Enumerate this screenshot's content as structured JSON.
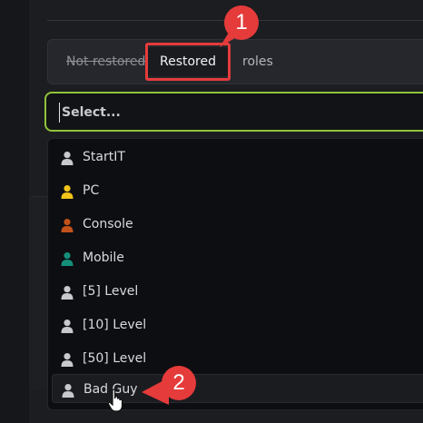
{
  "toggle": {
    "not_restored": "Not restored",
    "restored": "Restored",
    "roles": "roles"
  },
  "select": {
    "placeholder": "Select..."
  },
  "options": [
    {
      "label": "StartIT",
      "color": "#c8c9cd",
      "icon": "user-icon"
    },
    {
      "label": "PC",
      "color": "#f0c419",
      "icon": "user-icon"
    },
    {
      "label": "Console",
      "color": "#c2521a",
      "icon": "user-icon"
    },
    {
      "label": "Mobile",
      "color": "#14907a",
      "icon": "user-icon"
    },
    {
      "label": "[5] Level",
      "color": "#c8c9cd",
      "icon": "user-icon"
    },
    {
      "label": "[10] Level",
      "color": "#c8c9cd",
      "icon": "user-icon"
    },
    {
      "label": "[50] Level",
      "color": "#c8c9cd",
      "icon": "user-icon"
    },
    {
      "label": "Bad Guy",
      "color": "#c8c9cd",
      "icon": "user-icon"
    }
  ],
  "annotations": {
    "badge1": "1",
    "badge2": "2",
    "color": "#e53b3b"
  },
  "colors": {
    "focus_border": "#8fc43a",
    "background": "#16171b"
  }
}
